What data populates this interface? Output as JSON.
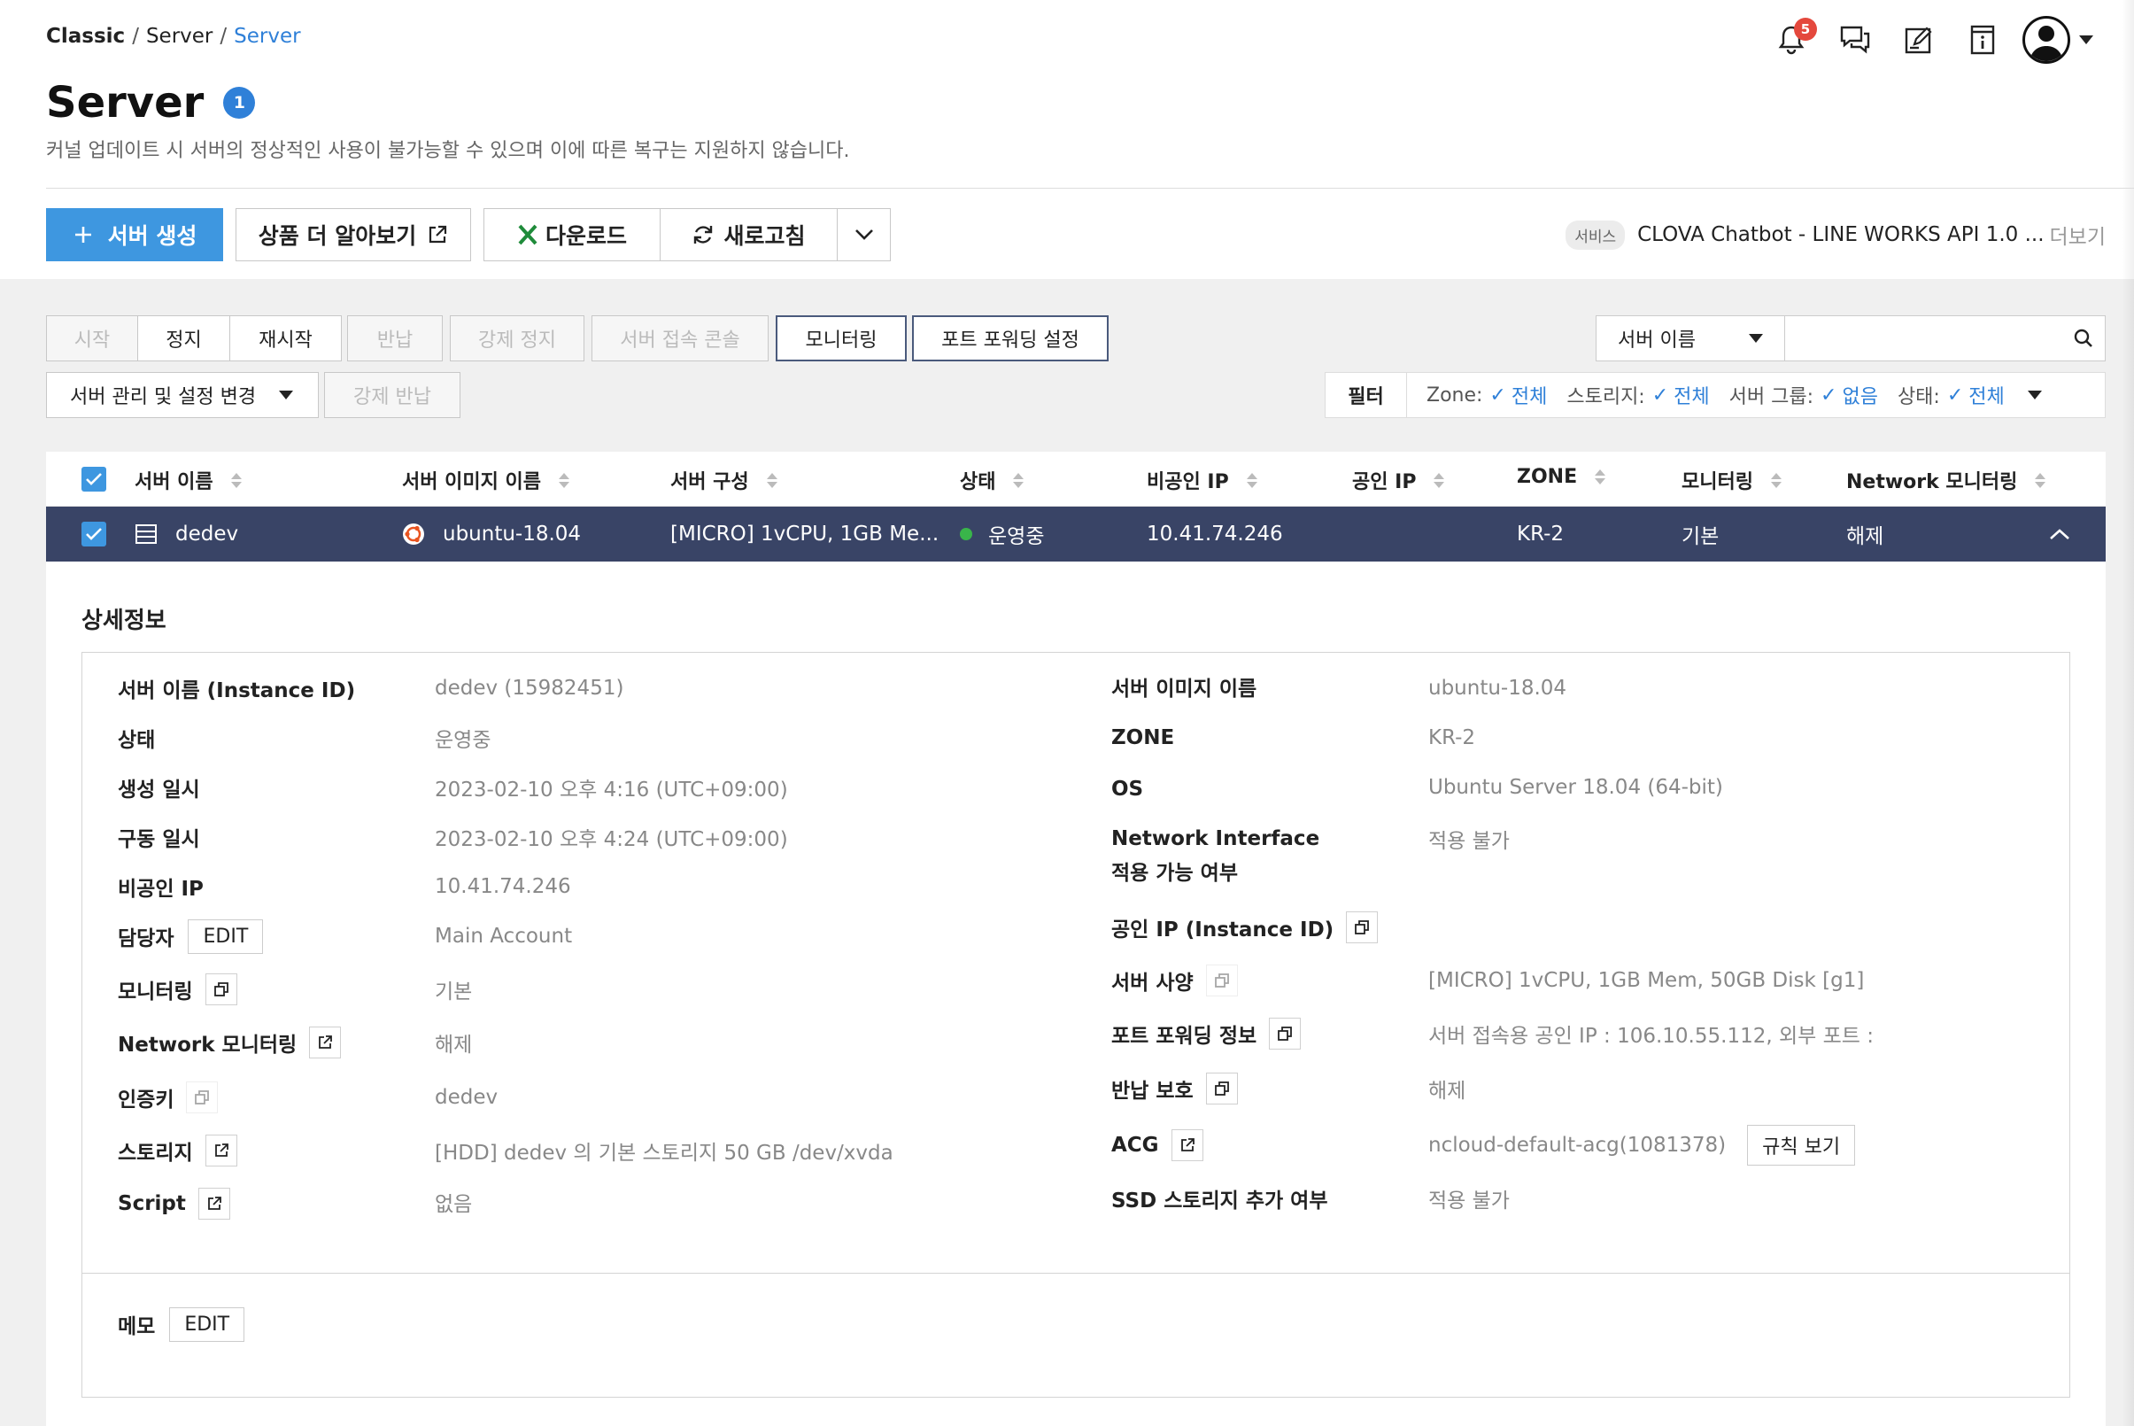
{
  "breadcrumb": {
    "root": "Classic",
    "mid": "Server",
    "current": "Server",
    "sep": "/"
  },
  "header": {
    "notification_count": "5"
  },
  "page": {
    "title": "Server",
    "count": "1",
    "description": "커널 업데이트 시 서버의 정상적인 사용이 불가능할 수 있으며 이에 따른 복구는 지원하지 않습니다."
  },
  "toolbar": {
    "create": "서버 생성",
    "learn_more": "상품 더 알아보기",
    "download": "다운로드",
    "refresh": "새로고침"
  },
  "service": {
    "tag": "서비스",
    "name": "CLOVA Chatbot - LINE WORKS API 1.0 ...",
    "more": "더보기"
  },
  "actions": {
    "start": "시작",
    "stop": "정지",
    "restart": "재시작",
    "return": "반납",
    "force_stop": "강제 정지",
    "console": "서버 접속 콘솔",
    "monitoring": "모니터링",
    "port_forwarding": "포트 포워딩 설정",
    "manage": "서버 관리 및 설정 변경",
    "force_return": "강제 반납"
  },
  "search": {
    "select": "서버 이름",
    "placeholder": ""
  },
  "filter": {
    "label": "필터",
    "zone_label": "Zone:",
    "zone_value": "전체",
    "storage_label": "스토리지:",
    "storage_value": "전체",
    "group_label": "서버 그룹:",
    "group_value": "없음",
    "status_label": "상태:",
    "status_value": "전체"
  },
  "table": {
    "headers": [
      "서버 이름",
      "서버 이미지 이름",
      "서버 구성",
      "상태",
      "비공인 IP",
      "공인 IP",
      "ZONE",
      "모니터링",
      "Network 모니터링"
    ],
    "row": {
      "name": "dedev",
      "image": "ubuntu-18.04",
      "spec": "[MICRO] 1vCPU, 1GB Me...",
      "status": "운영중",
      "private_ip": "10.41.74.246",
      "public_ip": "",
      "zone": "KR-2",
      "monitoring": "기본",
      "net_monitoring": "해제"
    }
  },
  "detail": {
    "title": "상세정보",
    "left": [
      {
        "label": "서버 이름 (Instance ID)",
        "value": "dedev (15982451)"
      },
      {
        "label": "상태",
        "value": "운영중"
      },
      {
        "label": "생성 일시",
        "value": "2023-02-10 오후 4:16 (UTC+09:00)"
      },
      {
        "label": "구동 일시",
        "value": "2023-02-10 오후 4:24 (UTC+09:00)"
      },
      {
        "label": "비공인 IP",
        "value": "10.41.74.246"
      },
      {
        "label": "담당자",
        "value": "Main Account"
      },
      {
        "label": "모니터링",
        "value": "기본"
      },
      {
        "label": "Network 모니터링",
        "value": "해제"
      },
      {
        "label": "인증키",
        "value": "dedev"
      },
      {
        "label": "스토리지",
        "value": "[HDD] dedev 의 기본 스토리지  50 GB /dev/xvda"
      },
      {
        "label": "Script",
        "value": "없음"
      }
    ],
    "right": [
      {
        "label": "서버 이미지 이름",
        "value": "ubuntu-18.04"
      },
      {
        "label": "ZONE",
        "value": "KR-2"
      },
      {
        "label": "OS",
        "value": "Ubuntu Server 18.04 (64-bit)"
      },
      {
        "label": "Network Interface",
        "label2": "적용 가능 여부",
        "value": "적용 불가"
      },
      {
        "label": "공인 IP (Instance ID)",
        "value": ""
      },
      {
        "label": "서버 사양",
        "value": "[MICRO] 1vCPU, 1GB Mem, 50GB Disk [g1]"
      },
      {
        "label": "포트 포워딩 정보",
        "value": "서버 접속용 공인 IP : 106.10.55.112, 외부 포트 :"
      },
      {
        "label": "반납 보호",
        "value": "해제"
      },
      {
        "label": "ACG",
        "value": "ncloud-default-acg(1081378)"
      },
      {
        "label": "SSD 스토리지 추가 여부",
        "value": "적용 불가"
      }
    ],
    "edit": "EDIT",
    "rule_view": "규칙 보기",
    "memo": "메모"
  }
}
